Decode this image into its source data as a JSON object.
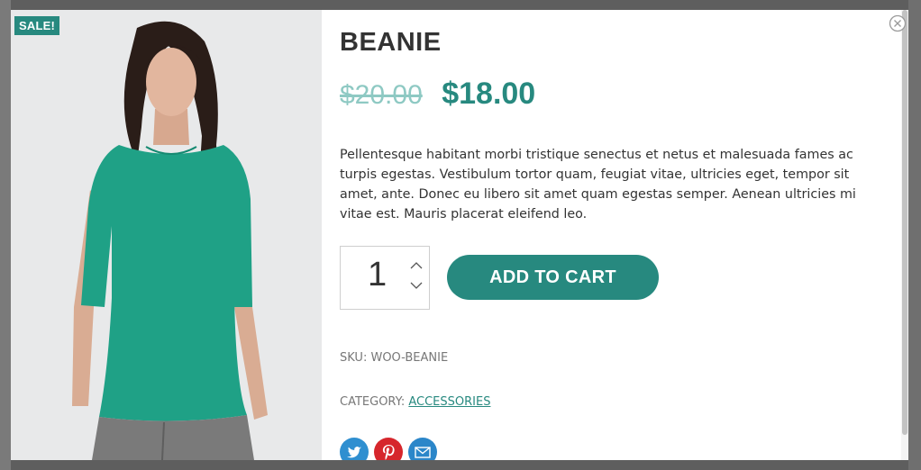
{
  "badge": {
    "sale": "SALE!"
  },
  "product": {
    "title": "BEANIE",
    "price_old": "$20.00",
    "price_new": "$18.00",
    "description": "Pellentesque habitant morbi tristique senectus et netus et malesuada fames ac turpis egestas. Vestibulum tortor quam, feugiat vitae, ultricies eget, tempor sit amet, ante. Donec eu libero sit amet quam egestas semper. Aenean ultricies mi vitae est. Mauris placerat eleifend leo.",
    "quantity": "1",
    "add_to_cart": "ADD TO CART",
    "sku_label": "SKU: ",
    "sku_value": "WOO-BEANIE",
    "category_label": "CATEGORY: ",
    "category_value": "ACCESSORIES"
  },
  "share": [
    "twitter-icon",
    "pinterest-icon",
    "email-icon"
  ],
  "colors": {
    "accent": "#27897f",
    "old_price": "#8ec9c3",
    "twitter": "#2f8fd0",
    "pinterest": "#d6262c",
    "email": "#2b86c9"
  }
}
